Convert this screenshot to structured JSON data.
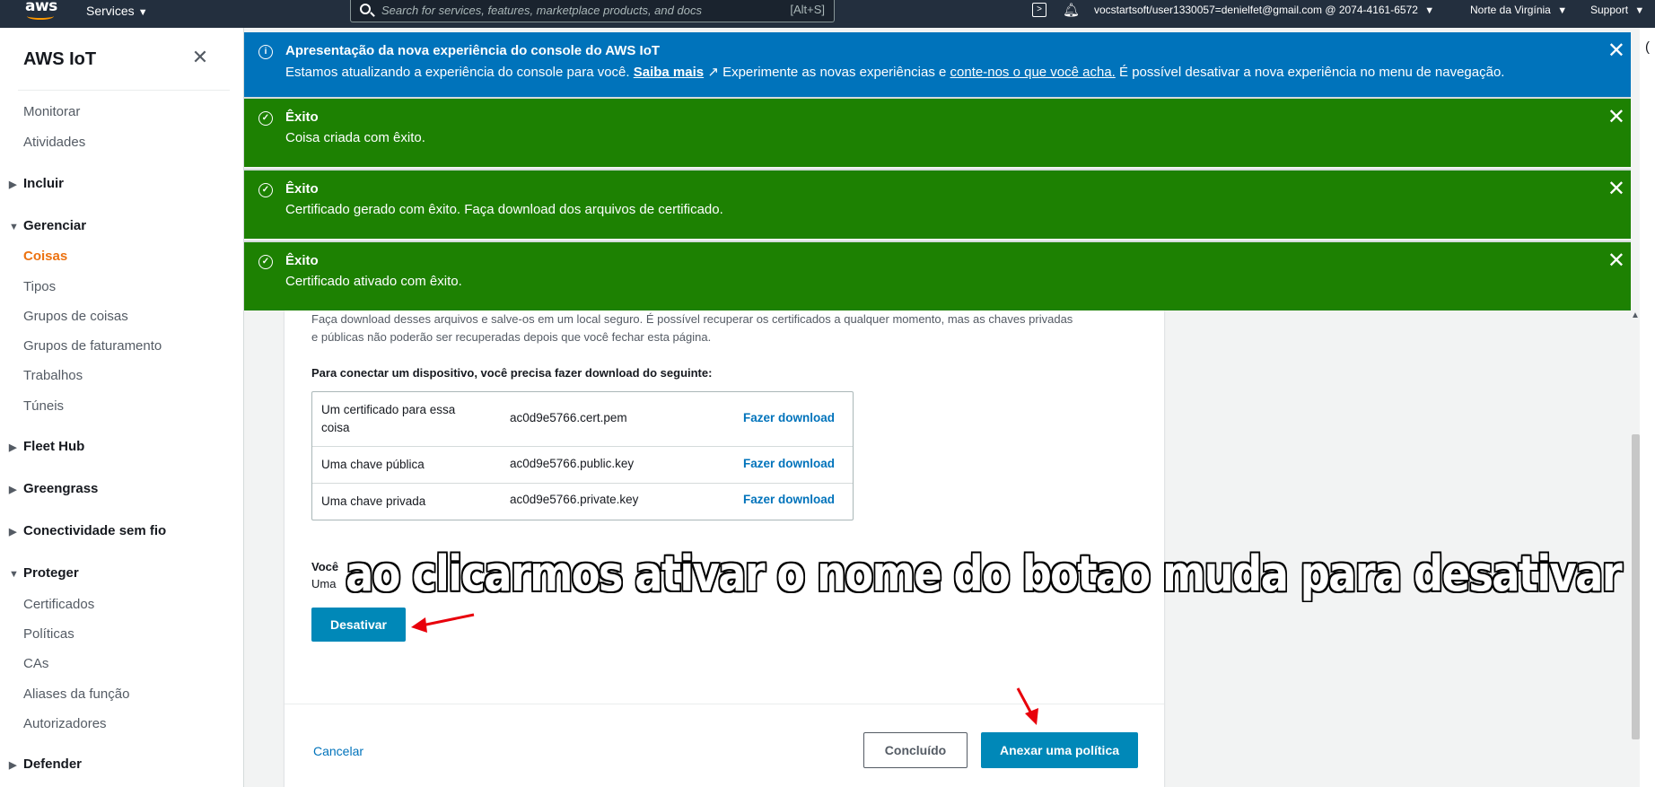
{
  "topnav": {
    "logo": "aws",
    "services_label": "Services",
    "search_placeholder": "Search for services, features, marketplace products, and docs",
    "search_shortcut": "[Alt+S]",
    "account": "vocstartsoft/user1330057=denielfet@gmail.com @ 2074-4161-6572",
    "region": "Norte da Virgínia",
    "support": "Support"
  },
  "sidebar": {
    "title": "AWS IoT",
    "items": [
      {
        "label": "Monitorar"
      },
      {
        "label": "Atividades"
      }
    ],
    "groups": [
      {
        "label": "Incluir",
        "expanded": false
      },
      {
        "label": "Gerenciar",
        "expanded": true,
        "items": [
          "Coisas",
          "Tipos",
          "Grupos de coisas",
          "Grupos de faturamento",
          "Trabalhos",
          "Túneis"
        ],
        "active": "Coisas"
      },
      {
        "label": "Fleet Hub",
        "expanded": false
      },
      {
        "label": "Greengrass",
        "expanded": false
      },
      {
        "label": "Conectividade sem fio",
        "expanded": false
      },
      {
        "label": "Proteger",
        "expanded": true,
        "items": [
          "Certificados",
          "Políticas",
          "CAs",
          "Aliases da função",
          "Autorizadores"
        ]
      },
      {
        "label": "Defender",
        "expanded": false
      }
    ]
  },
  "flash": {
    "info": {
      "title": "Apresentação da nova experiência do console do AWS IoT",
      "body_prefix": "Estamos atualizando a experiência do console para você.",
      "link_more": "Saiba mais",
      "body_mid": "Experimente as novas experiências e",
      "link_tell": "conte-nos o que você acha.",
      "body_suffix": "É possível desativar a nova experiência no menu de navegação."
    },
    "success": [
      {
        "title": "Êxito",
        "body": "Coisa criada com êxito."
      },
      {
        "title": "Êxito",
        "body": "Certificado gerado com êxito. Faça download dos arquivos de certificado."
      },
      {
        "title": "Êxito",
        "body": "Certificado ativado com êxito."
      }
    ]
  },
  "content": {
    "intro_line1": "Faça download desses arquivos e salve-os em um local seguro. É possível recuperar os certificados a qualquer momento, mas as chaves privadas",
    "intro_line2": "e públicas não poderão ser recuperadas depois que você fechar esta página.",
    "download_heading": "Para conectar um dispositivo, você precisa fazer download do seguinte:",
    "downloads": [
      {
        "item": "Um certificado para essa coisa",
        "file": "ac0d9e5766.cert.pem",
        "action": "Fazer download"
      },
      {
        "item": "Uma chave pública",
        "file": "ac0d9e5766.public.key",
        "action": "Fazer download"
      },
      {
        "item": "Uma chave privada",
        "file": "ac0d9e5766.private.key",
        "action": "Fazer download"
      }
    ],
    "question_line1": "Você",
    "question_line2": "Uma",
    "deactivate_button": "Desativar",
    "cancel_link": "Cancelar",
    "done_button": "Concluído",
    "attach_policy_button": "Anexar uma política"
  },
  "annotation": {
    "text": "ao clicarmos ativar o nome do botao muda para desativar"
  },
  "colors": {
    "nav_bg": "#232f3e",
    "info_blue": "#0073bb",
    "success_green": "#1d8102",
    "primary_button": "#0088b8",
    "active_orange": "#ec7211",
    "arrow_red": "#e8000b"
  }
}
